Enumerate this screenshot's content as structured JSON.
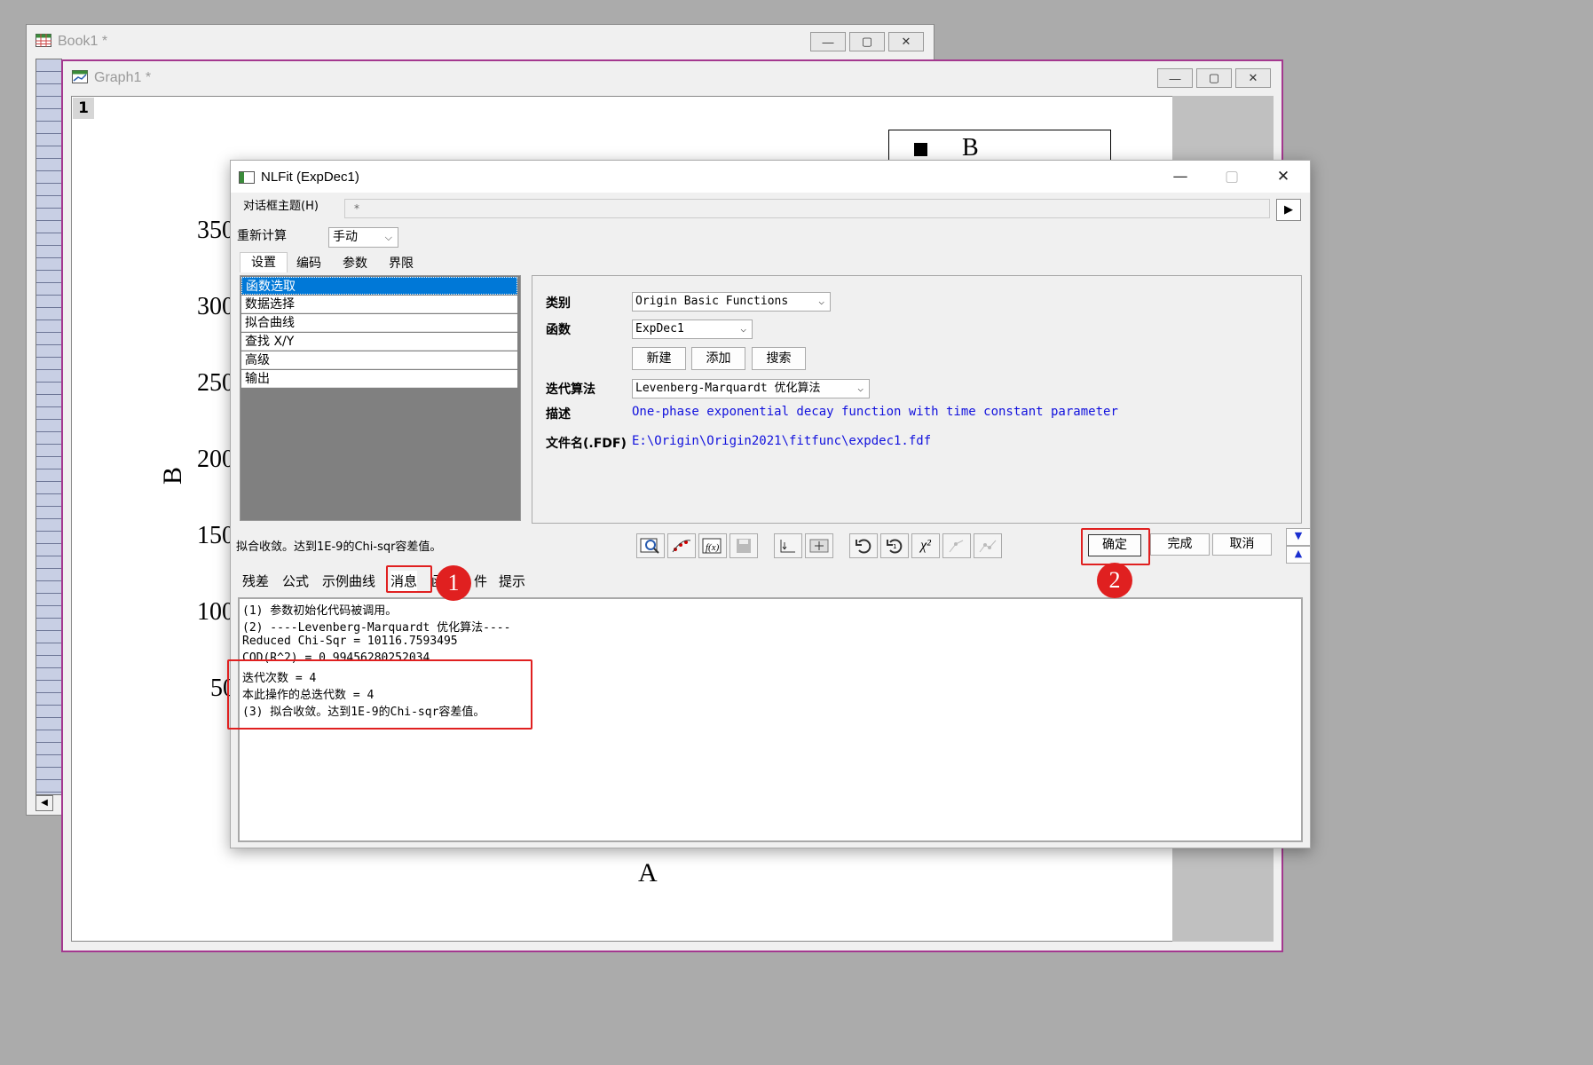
{
  "book_window": {
    "title": "Book1 *"
  },
  "graph_window": {
    "title": "Graph1 *",
    "layer_number": "1",
    "legend_label": "B",
    "x_axis_label": "A",
    "y_axis_label": "B",
    "y_ticks": [
      "350",
      "300",
      "250",
      "200",
      "150",
      "100",
      "50"
    ]
  },
  "window_controls": {
    "minimize": "—",
    "restore": "▢",
    "close": "✕"
  },
  "dialog": {
    "title": "NLFit (ExpDec1)",
    "theme_label": "对话框主题(H)",
    "theme_value": "*",
    "theme_arrow": "▶",
    "recalc_label": "重新计算",
    "recalc_value": "手动",
    "top_tabs": [
      "设置",
      "编码",
      "参数",
      "界限"
    ],
    "left_items": [
      "函数选取",
      "数据选择",
      "拟合曲线",
      "查找 X/Y",
      "高级",
      "输出"
    ],
    "panel": {
      "category_label": "类别",
      "category_value": "Origin Basic Functions",
      "function_label": "函数",
      "function_value": "ExpDec1",
      "btn_new": "新建",
      "btn_add": "添加",
      "btn_search": "搜索",
      "iter_label": "迭代算法",
      "iter_value": "Levenberg-Marquardt 优化算法",
      "desc_label": "描述",
      "desc_value": "One-phase exponential decay function with time constant parameter",
      "file_label": "文件名(.FDF)",
      "file_value": "E:\\Origin\\Origin2021\\fitfunc\\expdec1.fdf"
    },
    "status_text": "拟合收敛。达到1E-9的Chi-sqr容差值。",
    "toolbar_icons": [
      "fit-preview-icon",
      "fit-points-icon",
      "fx-icon",
      "save-icon",
      "baseline-icon",
      "range-icon",
      "undo-icon",
      "redo-icon",
      "chi-square-icon",
      "one-iteration-icon",
      "fit-until-converged-icon"
    ],
    "chi_label": "χ²",
    "ok_label": "确定",
    "done_label": "完成",
    "cancel_label": "取消",
    "collapse_down": "▼",
    "collapse_up": "▲",
    "bottom_tabs": [
      "残差",
      "公式",
      "示例曲线",
      "消息",
      "函",
      "件",
      "提示"
    ],
    "messages": [
      "(1) 参数初始化代码被调用。",
      "(2) ----Levenberg-Marquardt 优化算法----",
      "Reduced Chi-Sqr = 10116.7593495",
      "COD(R^2) = 0.99456280252034",
      "迭代次数 = 4",
      "本此操作的总迭代数 = 4",
      "(3) 拟合收敛。达到1E-9的Chi-sqr容差值。"
    ]
  },
  "annotations": {
    "step1": "1",
    "step2": "2"
  },
  "colors": {
    "accent_selection": "#0078d7",
    "annotation_red": "#e02020",
    "graph_border": "#a4388f",
    "link_blue": "#1111dd"
  }
}
